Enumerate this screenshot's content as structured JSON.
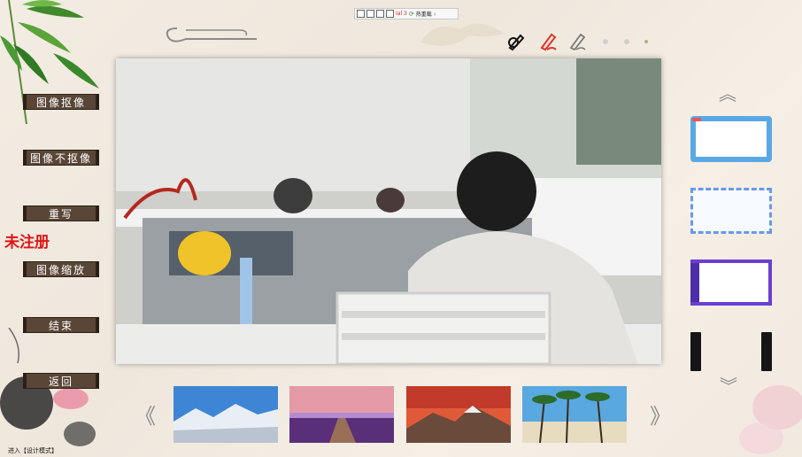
{
  "toolbar": {
    "red_text": "Ial 3",
    "hotkey_label": "热重载"
  },
  "menu": {
    "items": [
      {
        "label": "图像抠像"
      },
      {
        "label": "图像不抠像"
      },
      {
        "label": "重写"
      },
      {
        "label": "图像缩放"
      },
      {
        "label": "结束"
      },
      {
        "label": "返回"
      }
    ]
  },
  "watermark": "未注册",
  "status_bar": "进入【设计模式】",
  "nav": {
    "up_arrow": "︽",
    "down_arrow": "︾",
    "prev_arrow": "《",
    "next_arrow": "》"
  },
  "icons": {
    "pen_black": "pen-icon",
    "pen_red": "highlighter-icon",
    "pen_outline": "pencil-icon"
  },
  "colors": {
    "menu_bg": "#5a4637",
    "watermark": "#e01414",
    "frame1": "#5aa9e6",
    "frame2": "#6a98e6",
    "frame3": "#6b3fd0"
  }
}
